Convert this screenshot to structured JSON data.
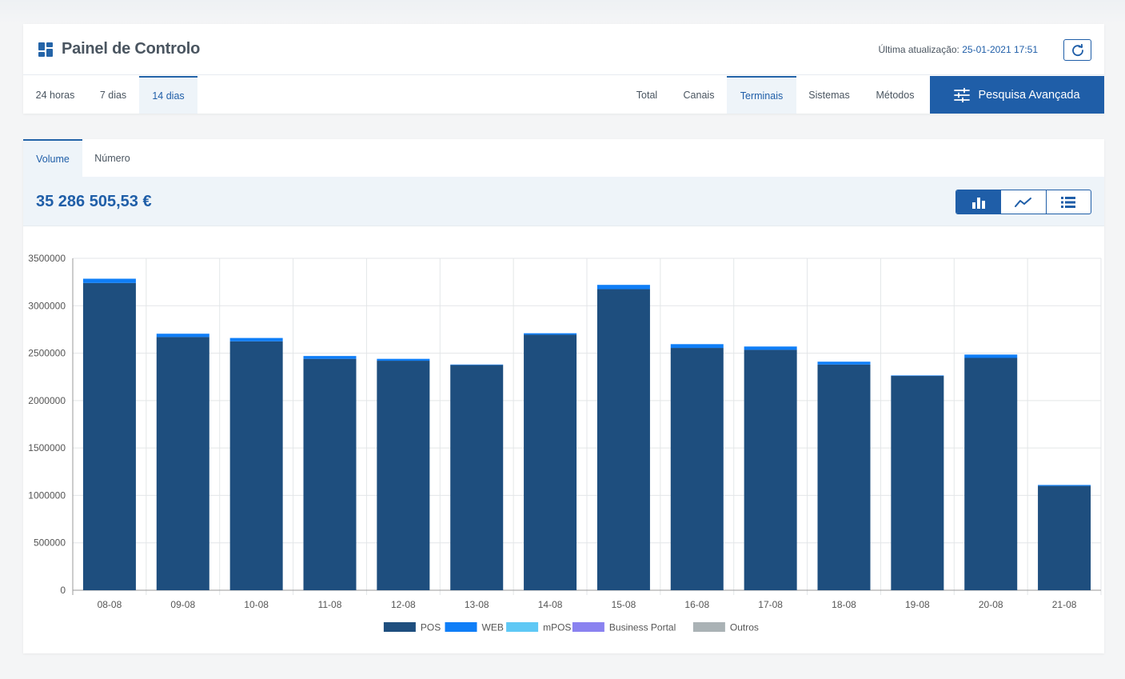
{
  "header": {
    "title": "Painel de Controlo",
    "last_update_label": "Última atualização:",
    "last_update_value": "25-01-2021 17:51",
    "refresh_icon": "refresh-icon",
    "dashboard_icon": "dashboard-grid-icon"
  },
  "period_tabs": [
    {
      "label": "24 horas"
    },
    {
      "label": "7 dias"
    },
    {
      "label": "14 dias",
      "active": true
    }
  ],
  "view_tabs": [
    {
      "label": "Total"
    },
    {
      "label": "Canais"
    },
    {
      "label": "Terminais",
      "active": true
    },
    {
      "label": "Sistemas"
    },
    {
      "label": "Métodos"
    }
  ],
  "search_button": {
    "label": "Pesquisa Avançada",
    "icon": "sliders-icon"
  },
  "metric_tabs": [
    {
      "label": "Volume",
      "active": true
    },
    {
      "label": "Número"
    }
  ],
  "total_value": "35 286 505,53 €",
  "chart_view_toggle": [
    {
      "icon": "bar-chart-icon",
      "active": true
    },
    {
      "icon": "line-chart-icon"
    },
    {
      "icon": "list-icon"
    }
  ],
  "colors": {
    "accent": "#1f5ea8",
    "POS": "#1e4e7e",
    "WEB": "#0f7ef7",
    "mPOS": "#5ec8f5",
    "Business Portal": "#8a82f0",
    "Outros": "#aab2b5"
  },
  "chart_data": {
    "type": "bar",
    "stacked": true,
    "categories": [
      "08-08",
      "09-08",
      "10-08",
      "11-08",
      "12-08",
      "13-08",
      "14-08",
      "15-08",
      "16-08",
      "17-08",
      "18-08",
      "19-08",
      "20-08",
      "21-08"
    ],
    "series": [
      {
        "name": "POS",
        "values": [
          3240000,
          2670000,
          2625000,
          2440000,
          2420000,
          2375000,
          2695000,
          3175000,
          2555000,
          2535000,
          2380000,
          2260000,
          2450000,
          1100000
        ]
      },
      {
        "name": "WEB",
        "values": [
          45000,
          35000,
          35000,
          30000,
          20000,
          5000,
          15000,
          45000,
          40000,
          35000,
          30000,
          5000,
          35000,
          10000
        ]
      },
      {
        "name": "mPOS",
        "values": [
          0,
          0,
          0,
          0,
          0,
          0,
          0,
          0,
          0,
          0,
          0,
          0,
          0,
          0
        ]
      },
      {
        "name": "Business Portal",
        "values": [
          0,
          0,
          0,
          0,
          0,
          0,
          0,
          0,
          0,
          0,
          0,
          0,
          0,
          0
        ]
      },
      {
        "name": "Outros",
        "values": [
          0,
          0,
          0,
          0,
          0,
          0,
          0,
          0,
          0,
          0,
          0,
          0,
          0,
          0
        ]
      }
    ],
    "yticks": [
      "0",
      "500000",
      "1000000",
      "1500000",
      "2000000",
      "2500000",
      "3000000",
      "3500000"
    ],
    "ylim": [
      0,
      3500000
    ],
    "grid": true,
    "legend_position": "bottom"
  }
}
